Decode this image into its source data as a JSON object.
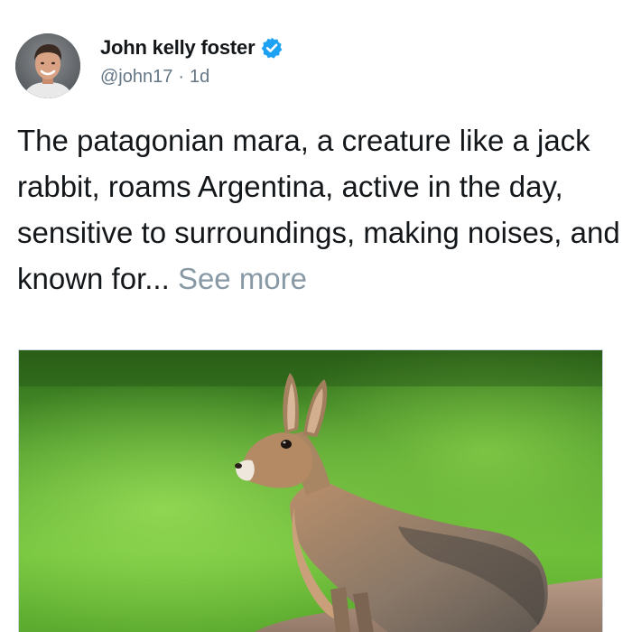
{
  "author": {
    "display_name": "John kelly foster",
    "handle": "@john17",
    "time": "1d",
    "separator": "·",
    "verified": true,
    "avatar_icon": "avatar-photo"
  },
  "tweet": {
    "text": "The patagonian mara, a creature like a jack rabbit, roams Argentina, active in the day, sensitive to surroundings, making noises, and known for... ",
    "see_more": "See more"
  },
  "media": {
    "type": "photo",
    "icon": "mara-photo"
  },
  "colors": {
    "text": "#14171a",
    "secondary": "#657786",
    "see_more": "#8899a6",
    "verified": "#1da1f2"
  }
}
